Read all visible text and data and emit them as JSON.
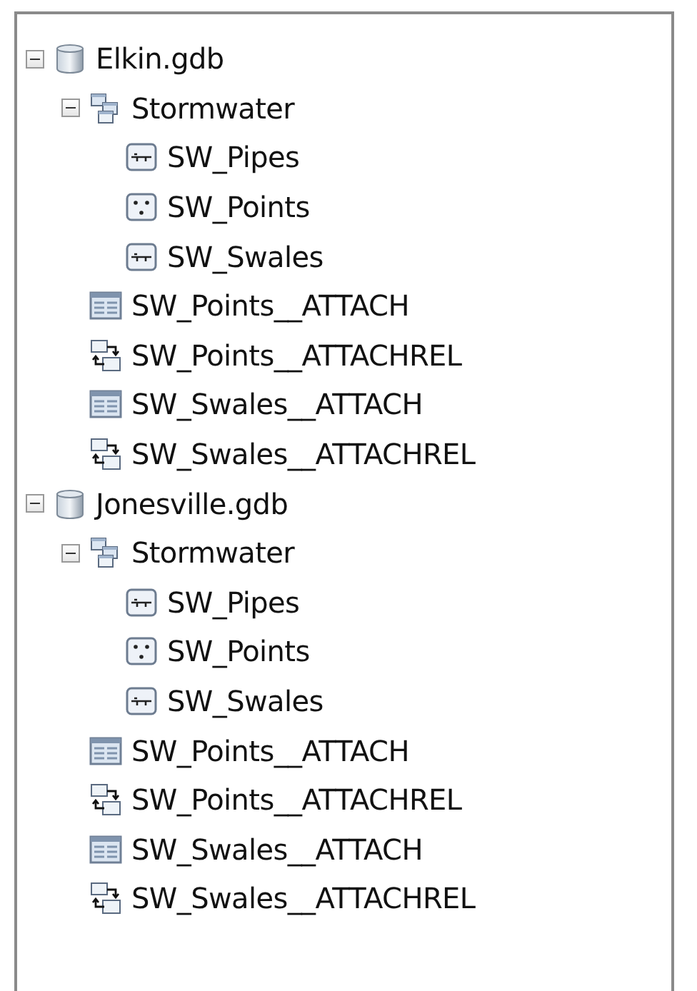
{
  "tree": [
    {
      "label": "Elkin.gdb",
      "kind": "database",
      "expanded": true,
      "children": [
        {
          "label": "Stormwater",
          "kind": "dataset",
          "expanded": true,
          "children": [
            {
              "label": "SW_Pipes",
              "kind": "line"
            },
            {
              "label": "SW_Points",
              "kind": "point"
            },
            {
              "label": "SW_Swales",
              "kind": "line"
            }
          ]
        },
        {
          "label": "SW_Points__ATTACH",
          "kind": "table"
        },
        {
          "label": "SW_Points__ATTACHREL",
          "kind": "relationship"
        },
        {
          "label": "SW_Swales__ATTACH",
          "kind": "table"
        },
        {
          "label": "SW_Swales__ATTACHREL",
          "kind": "relationship"
        }
      ]
    },
    {
      "label": "Jonesville.gdb",
      "kind": "database",
      "expanded": true,
      "children": [
        {
          "label": "Stormwater",
          "kind": "dataset",
          "expanded": true,
          "children": [
            {
              "label": "SW_Pipes",
              "kind": "line"
            },
            {
              "label": "SW_Points",
              "kind": "point"
            },
            {
              "label": "SW_Swales",
              "kind": "line"
            }
          ]
        },
        {
          "label": "SW_Points__ATTACH",
          "kind": "table"
        },
        {
          "label": "SW_Points__ATTACHREL",
          "kind": "relationship"
        },
        {
          "label": "SW_Swales__ATTACH",
          "kind": "table"
        },
        {
          "label": "SW_Swales__ATTACHREL",
          "kind": "relationship"
        }
      ]
    }
  ]
}
